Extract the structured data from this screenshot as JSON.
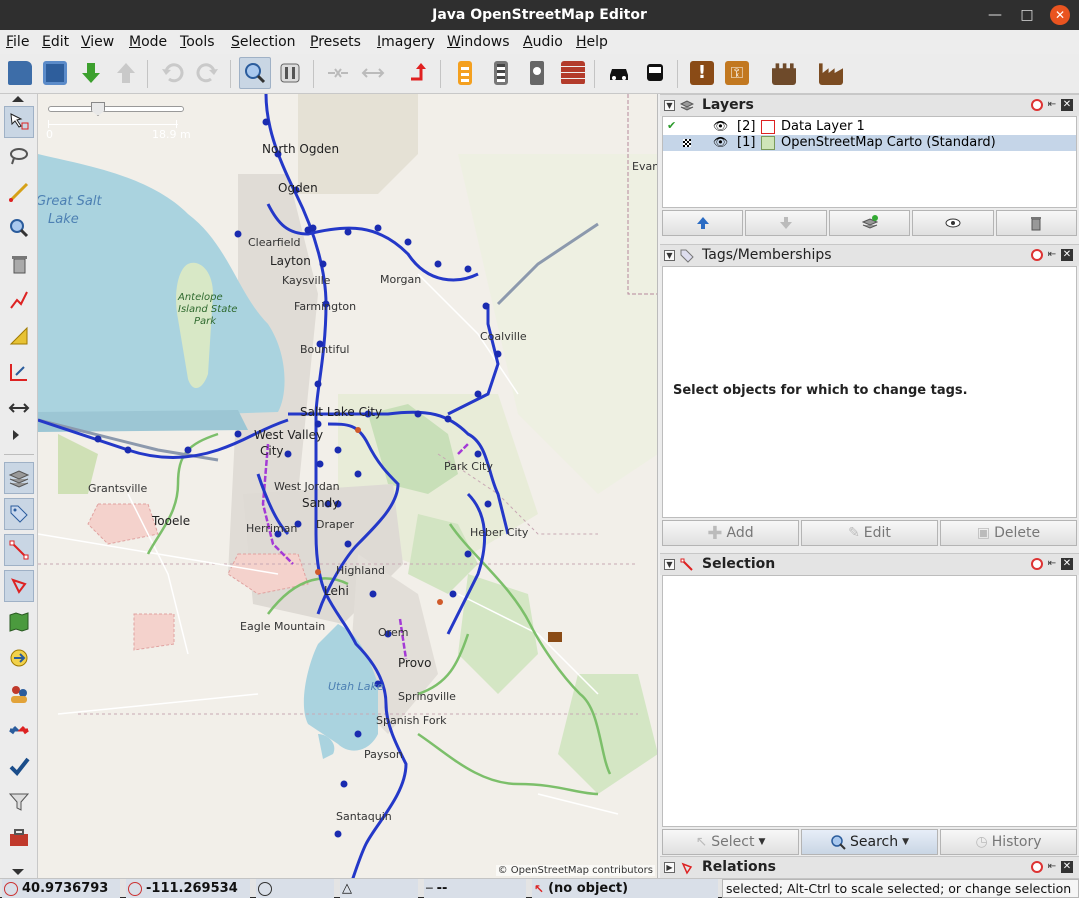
{
  "window": {
    "title": "Java OpenStreetMap Editor"
  },
  "menu": [
    "File",
    "Edit",
    "View",
    "Mode",
    "Tools",
    "Selection",
    "Presets",
    "Imagery",
    "Windows",
    "Audio",
    "Help"
  ],
  "toolbar": {
    "buttons": [
      "open-file",
      "save",
      "download",
      "upload",
      "undo",
      "redo",
      "zoom",
      "preferences",
      "merge-nodes",
      "split-way",
      "reverse-way",
      "highway-preset",
      "track-preset",
      "footway-preset",
      "wall-preset",
      "car-preset",
      "bus-preset",
      "amenity-preset",
      "restaurant-preset",
      "castle-preset",
      "industrial-preset"
    ]
  },
  "map": {
    "scale_start": "0",
    "scale_end": "18.9 m",
    "attribution": "© OpenStreetMap contributors",
    "labels": {
      "north_ogden": "North Ogden",
      "ogden": "Ogden",
      "great_salt_lake_1": "Great Salt",
      "great_salt_lake_2": "Lake",
      "clearfield": "Clearfield",
      "layton": "Layton",
      "kaysville": "Kaysville",
      "farmington": "Farmington",
      "bountiful": "Bountiful",
      "morgan": "Morgan",
      "coalville": "Coalville",
      "evanston": "Evan",
      "antelope_1": "Antelope",
      "antelope_2": "Island State",
      "antelope_3": "Park",
      "slc": "Salt Lake City",
      "west_valley": "West Valley",
      "west_valley_2": "City",
      "park_city": "Park City",
      "grantsville": "Grantsville",
      "tooele": "Tooele",
      "west_jordan": "West Jordan",
      "sandy": "Sandy",
      "herriman": "Herriman",
      "draper": "Draper",
      "heber": "Heber City",
      "highland": "Highland",
      "lehi": "Lehi",
      "eagle_mountain": "Eagle Mountain",
      "orem": "Orem",
      "provo": "Provo",
      "utah_lake": "Utah Lake",
      "springville": "Springville",
      "spanish_fork": "Spanish Fork",
      "payson": "Payson",
      "santaquin": "Santaquin"
    }
  },
  "panels": {
    "layers": {
      "title": "Layers",
      "rows": [
        {
          "index": "[2]",
          "name": "Data Layer 1"
        },
        {
          "index": "[1]",
          "name": "OpenStreetMap Carto (Standard)"
        }
      ]
    },
    "tags": {
      "title": "Tags/Memberships",
      "empty_text": "Select objects for which to change tags.",
      "add": "Add",
      "edit": "Edit",
      "delete": "Delete"
    },
    "selection": {
      "title": "Selection",
      "select": "Select",
      "search": "Search",
      "history": "History"
    },
    "relations": {
      "title": "Relations"
    }
  },
  "status": {
    "lat": "40.9736793",
    "lon": "-111.269534",
    "distance": "--",
    "object": "(no object)",
    "help": "selected; Alt-Ctrl to scale selected; or change selection"
  }
}
